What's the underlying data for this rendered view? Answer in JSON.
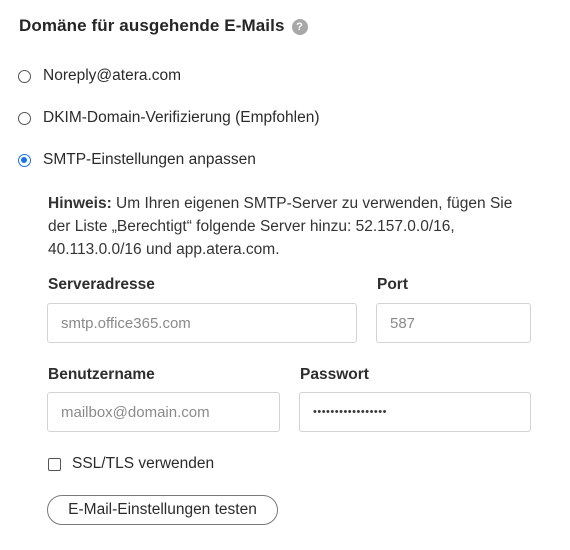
{
  "section": {
    "title": "Domäne für ausgehende E-Mails",
    "help_icon": "?"
  },
  "options": {
    "noreply": "Noreply@atera.com",
    "dkim": "DKIM-Domain-Verifizierung (Empfohlen)",
    "smtp": "SMTP-Einstellungen anpassen",
    "selected": "smtp"
  },
  "note": {
    "label": "Hinweis:",
    "text": " Um Ihren eigenen SMTP-Server zu verwenden, fügen Sie der Liste „Berechtigt“ folgende Server hinzu: 52.157.0.0/16, 40.113.0.0/16 und app.atera.com."
  },
  "fields": {
    "server": {
      "label": "Serveradresse",
      "placeholder": "smtp.office365.com"
    },
    "port": {
      "label": "Port",
      "placeholder": "587"
    },
    "username": {
      "label": "Benutzername",
      "placeholder": "mailbox@domain.com"
    },
    "password": {
      "label": "Passwort",
      "value": "•••••••••••••••••"
    }
  },
  "ssl": {
    "label": "SSL/TLS verwenden",
    "checked": false
  },
  "test_button": {
    "label": "E-Mail-Einstellungen testen"
  },
  "colors": {
    "accent": "#1a73e8",
    "help_icon_bg": "#a8a8a8",
    "border": "#d3d3d3"
  }
}
